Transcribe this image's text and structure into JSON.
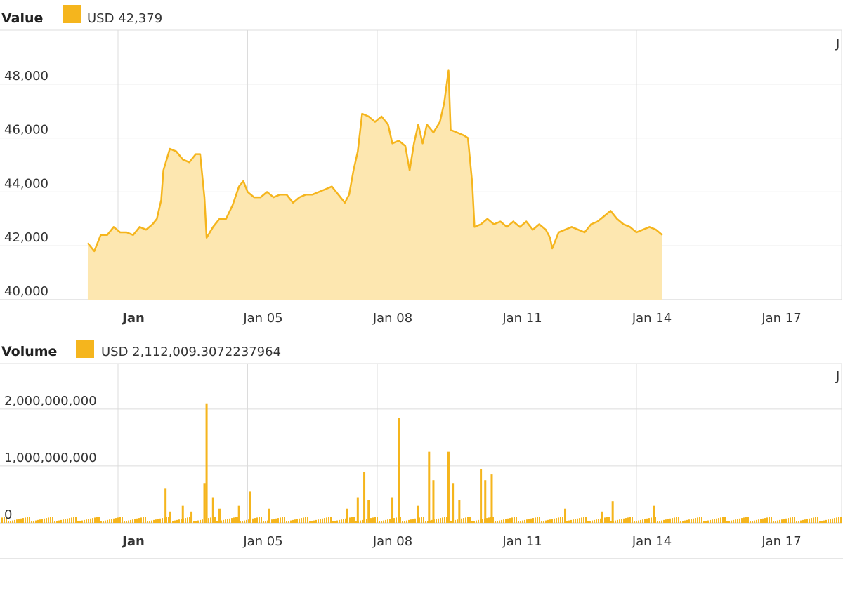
{
  "colors": {
    "accent": "#f5b51d",
    "fill": "#fde7b0",
    "grid": "#dcdcdc"
  },
  "value_panel": {
    "title": "Value",
    "legend": "USD 42,379",
    "right_edge_marker": "J"
  },
  "volume_panel": {
    "title": "Volume",
    "legend": "USD 2,112,009.3072237964",
    "right_edge_marker": "J"
  },
  "chart_data": [
    {
      "type": "area",
      "title": "Value",
      "legend": [
        "USD 42,379"
      ],
      "xlabel": "",
      "ylabel": "",
      "ylim": [
        40000,
        50000
      ],
      "yticks": [
        "40,000",
        "42,000",
        "44,000",
        "46,000",
        "48,000"
      ],
      "xticks": [
        "Jan",
        "Jan 05",
        "Jan 08",
        "Jan 11",
        "Jan 14",
        "Jan 17"
      ],
      "x_range_days": [
        1.3,
        17.5
      ],
      "grid": true,
      "series": [
        {
          "values": [
            [
              1.3,
              42100
            ],
            [
              1.45,
              41800
            ],
            [
              1.6,
              42400
            ],
            [
              1.75,
              42400
            ],
            [
              1.9,
              42700
            ],
            [
              2.05,
              42500
            ],
            [
              2.2,
              42500
            ],
            [
              2.35,
              42400
            ],
            [
              2.5,
              42700
            ],
            [
              2.65,
              42600
            ],
            [
              2.8,
              42800
            ],
            [
              2.9,
              43000
            ],
            [
              3.0,
              43700
            ],
            [
              3.05,
              44800
            ],
            [
              3.2,
              45600
            ],
            [
              3.35,
              45500
            ],
            [
              3.5,
              45200
            ],
            [
              3.65,
              45100
            ],
            [
              3.8,
              45400
            ],
            [
              3.9,
              45400
            ],
            [
              4.0,
              43800
            ],
            [
              4.05,
              42300
            ],
            [
              4.2,
              42700
            ],
            [
              4.35,
              43000
            ],
            [
              4.5,
              43000
            ],
            [
              4.65,
              43500
            ],
            [
              4.8,
              44200
            ],
            [
              4.9,
              44400
            ],
            [
              5.0,
              44000
            ],
            [
              5.15,
              43800
            ],
            [
              5.3,
              43800
            ],
            [
              5.45,
              44000
            ],
            [
              5.6,
              43800
            ],
            [
              5.75,
              43900
            ],
            [
              5.9,
              43900
            ],
            [
              6.05,
              43600
            ],
            [
              6.2,
              43800
            ],
            [
              6.35,
              43900
            ],
            [
              6.5,
              43900
            ],
            [
              6.65,
              44000
            ],
            [
              6.8,
              44100
            ],
            [
              6.95,
              44200
            ],
            [
              7.1,
              43900
            ],
            [
              7.25,
              43600
            ],
            [
              7.35,
              43900
            ],
            [
              7.45,
              44800
            ],
            [
              7.55,
              45500
            ],
            [
              7.65,
              46900
            ],
            [
              7.8,
              46800
            ],
            [
              7.95,
              46600
            ],
            [
              8.1,
              46800
            ],
            [
              8.25,
              46500
            ],
            [
              8.35,
              45800
            ],
            [
              8.5,
              45900
            ],
            [
              8.65,
              45700
            ],
            [
              8.75,
              44800
            ],
            [
              8.85,
              45800
            ],
            [
              8.95,
              46500
            ],
            [
              9.05,
              45800
            ],
            [
              9.15,
              46500
            ],
            [
              9.3,
              46200
            ],
            [
              9.45,
              46600
            ],
            [
              9.55,
              47300
            ],
            [
              9.65,
              48500
            ],
            [
              9.7,
              46300
            ],
            [
              9.85,
              46200
            ],
            [
              10.0,
              46100
            ],
            [
              10.1,
              46000
            ],
            [
              10.2,
              44300
            ],
            [
              10.25,
              42700
            ],
            [
              10.4,
              42800
            ],
            [
              10.55,
              43000
            ],
            [
              10.7,
              42800
            ],
            [
              10.85,
              42900
            ],
            [
              11.0,
              42700
            ],
            [
              11.15,
              42900
            ],
            [
              11.3,
              42700
            ],
            [
              11.45,
              42900
            ],
            [
              11.6,
              42600
            ],
            [
              11.75,
              42800
            ],
            [
              11.9,
              42600
            ],
            [
              12.0,
              42300
            ],
            [
              12.05,
              41900
            ],
            [
              12.2,
              42500
            ],
            [
              12.35,
              42600
            ],
            [
              12.5,
              42700
            ],
            [
              12.65,
              42600
            ],
            [
              12.8,
              42500
            ],
            [
              12.95,
              42800
            ],
            [
              13.1,
              42900
            ],
            [
              13.25,
              43100
            ],
            [
              13.4,
              43300
            ],
            [
              13.55,
              43000
            ],
            [
              13.7,
              42800
            ],
            [
              13.85,
              42700
            ],
            [
              14.0,
              42500
            ],
            [
              14.15,
              42600
            ],
            [
              14.3,
              42700
            ],
            [
              14.45,
              42600
            ],
            [
              14.6,
              42400
            ]
          ]
        }
      ]
    },
    {
      "type": "bar",
      "title": "Volume",
      "legend": [
        "USD 2,112,009.3072237964"
      ],
      "xlabel": "",
      "ylabel": "",
      "ylim": [
        0,
        2800000000
      ],
      "yticks": [
        "0",
        "1,000,000,000",
        "2,000,000,000"
      ],
      "xticks": [
        "Jan",
        "Jan 05",
        "Jan 08",
        "Jan 11",
        "Jan 14",
        "Jan 17"
      ],
      "x_range_days": [
        1.3,
        17.5
      ],
      "grid": true,
      "series": [
        {
          "values": [
            [
              3.1,
              600000000
            ],
            [
              3.2,
              200000000
            ],
            [
              3.5,
              300000000
            ],
            [
              3.7,
              200000000
            ],
            [
              4.0,
              700000000
            ],
            [
              4.05,
              2100000000
            ],
            [
              4.2,
              450000000
            ],
            [
              4.35,
              250000000
            ],
            [
              4.8,
              300000000
            ],
            [
              5.05,
              550000000
            ],
            [
              5.5,
              250000000
            ],
            [
              7.3,
              250000000
            ],
            [
              7.55,
              450000000
            ],
            [
              7.7,
              900000000
            ],
            [
              7.8,
              400000000
            ],
            [
              8.35,
              450000000
            ],
            [
              8.5,
              1850000000
            ],
            [
              8.95,
              300000000
            ],
            [
              9.2,
              1250000000
            ],
            [
              9.3,
              750000000
            ],
            [
              9.65,
              1250000000
            ],
            [
              9.75,
              700000000
            ],
            [
              9.9,
              400000000
            ],
            [
              10.4,
              950000000
            ],
            [
              10.5,
              750000000
            ],
            [
              10.65,
              850000000
            ],
            [
              12.35,
              250000000
            ],
            [
              13.2,
              200000000
            ],
            [
              13.45,
              380000000
            ],
            [
              14.4,
              300000000
            ]
          ]
        }
      ]
    }
  ]
}
